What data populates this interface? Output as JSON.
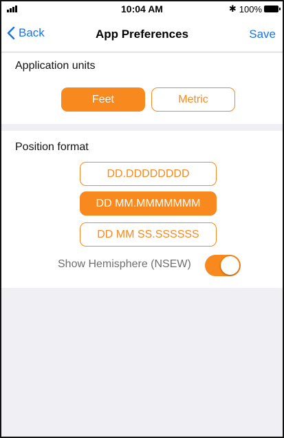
{
  "status_bar": {
    "time": "10:04 AM",
    "bluetooth_icon": "bluetooth-icon",
    "battery_percent": "100%",
    "battery_level": 1.0
  },
  "nav": {
    "back_label": "Back",
    "title": "App Preferences",
    "save_label": "Save"
  },
  "units": {
    "label": "Application units",
    "options": [
      "Feet",
      "Metric"
    ],
    "selected": "Feet"
  },
  "position_format": {
    "label": "Position format",
    "options": [
      "DD.DDDDDDDD",
      "DD MM.MMMMMMM",
      "DD MM SS.SSSSSS"
    ],
    "selected": "DD MM.MMMMMMM",
    "hemisphere_label": "Show Hemisphere (NSEW)",
    "hemisphere_on": true
  },
  "colors": {
    "accent": "#f7891e",
    "link": "#1a73e8",
    "background": "#efeff4"
  }
}
